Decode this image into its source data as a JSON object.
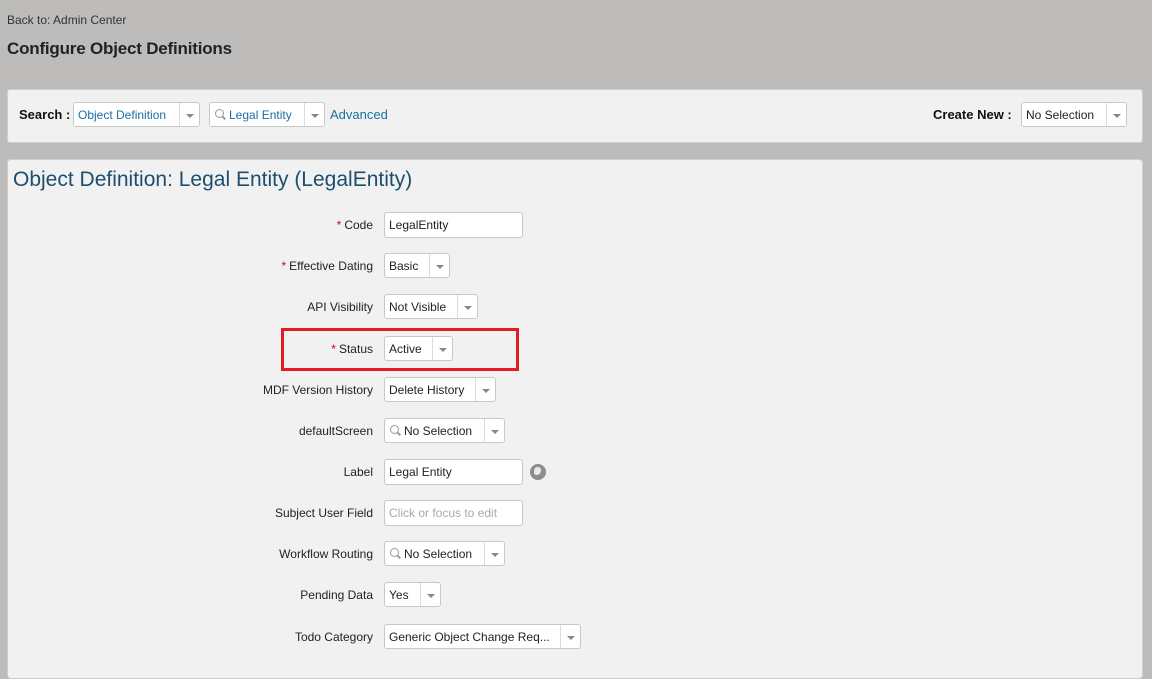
{
  "header": {
    "back_link": "Back to: Admin Center",
    "title": "Configure Object Definitions"
  },
  "search": {
    "label": "Search :",
    "type_value": "Object Definition",
    "object_value": "Legal Entity",
    "advanced_label": "Advanced",
    "create_label": "Create New :",
    "create_value": "No Selection"
  },
  "panel": {
    "title": "Object Definition: Legal Entity (LegalEntity)"
  },
  "fields": {
    "code": {
      "label": "Code",
      "required": "*",
      "value": "LegalEntity"
    },
    "effective_dating": {
      "label": "Effective Dating",
      "required": "*",
      "value": "Basic"
    },
    "api_visibility": {
      "label": "API Visibility",
      "value": "Not Visible"
    },
    "status": {
      "label": "Status",
      "required": "*",
      "value": "Active"
    },
    "mdf_version_history": {
      "label": "MDF Version History",
      "value": "Delete History"
    },
    "default_screen": {
      "label": "defaultScreen",
      "value": "No Selection"
    },
    "label": {
      "label": "Label",
      "value": "Legal Entity"
    },
    "subject_user_field": {
      "label": "Subject User Field",
      "placeholder": "Click or focus to edit"
    },
    "workflow_routing": {
      "label": "Workflow Routing",
      "value": "No Selection"
    },
    "pending_data": {
      "label": "Pending Data",
      "value": "Yes"
    },
    "todo_category": {
      "label": "Todo Category",
      "value": "Generic Object Change Req..."
    }
  },
  "icons": {
    "translation": "globe-icon",
    "search": "search-icon",
    "dropdown": "chevron-down-icon"
  },
  "colors": {
    "background": "#bdbcbb",
    "panel": "#f1f1f1",
    "link": "#1a6fa3",
    "title": "#1d4e6e",
    "required": "#d0021b",
    "highlight": "#e31b23"
  }
}
